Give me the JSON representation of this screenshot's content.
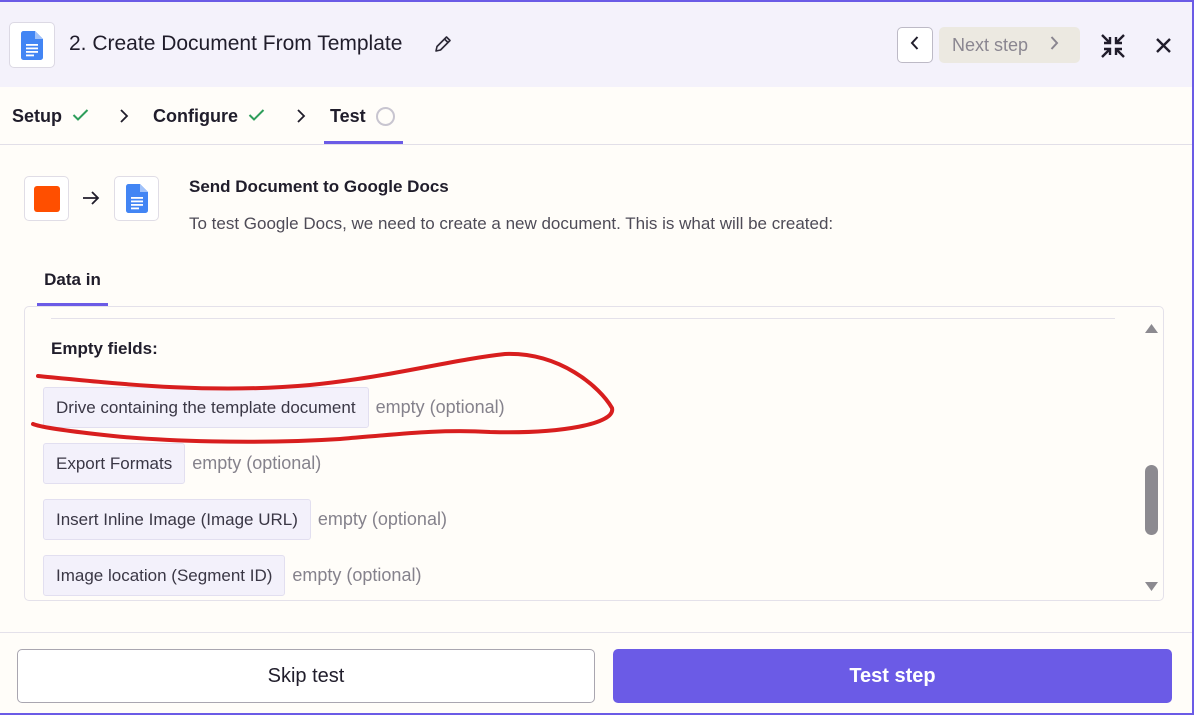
{
  "header": {
    "title": "2. Create Document From Template",
    "app_icon": "google-docs-icon",
    "next_label": "Next step"
  },
  "stepper": {
    "steps": [
      {
        "label": "Setup",
        "status": "done"
      },
      {
        "label": "Configure",
        "status": "done"
      },
      {
        "label": "Test",
        "status": "current"
      }
    ]
  },
  "section": {
    "title": "Send Document to Google Docs",
    "description": "To test Google Docs, we need to create a new document. This is what will be created:"
  },
  "tabs": {
    "data_in": "Data in"
  },
  "fields": {
    "heading": "Empty fields:",
    "items": [
      {
        "name": "Drive containing the template document",
        "value": "empty (optional)"
      },
      {
        "name": "Export Formats",
        "value": "empty (optional)"
      },
      {
        "name": "Insert Inline Image (Image URL)",
        "value": "empty (optional)"
      },
      {
        "name": "Image location (Segment ID)",
        "value": "empty (optional)"
      }
    ]
  },
  "footer": {
    "skip_label": "Skip test",
    "test_label": "Test step"
  },
  "colors": {
    "accent": "#6b5be6",
    "zapier_orange": "#ff4f00",
    "docs_blue": "#4285f4",
    "check_green": "#2e9e5b",
    "annotation_red": "#d81e1e"
  }
}
